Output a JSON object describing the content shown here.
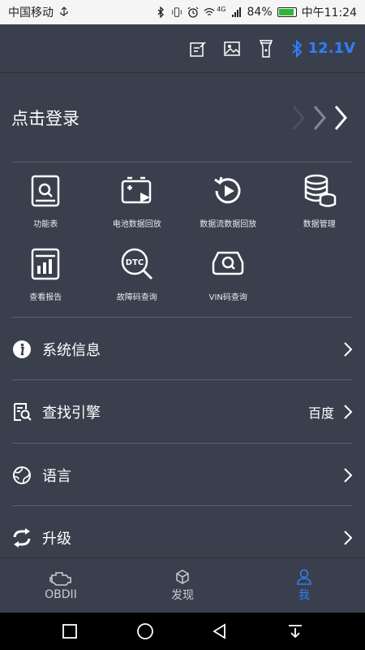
{
  "status_bar": {
    "carrier": "中国移动",
    "network": "4G",
    "battery": "84%",
    "time": "中午11:24"
  },
  "top_bar": {
    "voltage": "12.1V",
    "icons": [
      "edit-note-icon",
      "image-icon",
      "flashlight-icon",
      "bluetooth-icon"
    ]
  },
  "login": {
    "label": "点击登录"
  },
  "features": [
    {
      "label": "功能表",
      "icon": "function-list-icon"
    },
    {
      "label": "电池数据回放",
      "icon": "battery-playback-icon"
    },
    {
      "label": "数据流数据回放",
      "icon": "data-stream-playback-icon"
    },
    {
      "label": "数据管理",
      "icon": "database-icon"
    },
    {
      "label": "查看报告",
      "icon": "report-icon"
    },
    {
      "label": "故障码查询",
      "icon": "dtc-search-icon"
    },
    {
      "label": "VIN码查询",
      "icon": "vin-search-icon"
    }
  ],
  "menu": {
    "system_info": {
      "label": "系统信息",
      "icon": "info-icon"
    },
    "search_engine": {
      "label": "查找引擎",
      "value": "百度",
      "icon": "search-doc-icon"
    },
    "language": {
      "label": "语言",
      "icon": "globe-icon"
    },
    "upgrade": {
      "label": "升级",
      "icon": "refresh-icon"
    }
  },
  "bottom_nav": {
    "obd": "OBDII",
    "discover": "发现",
    "me": "我"
  },
  "colors": {
    "accent": "#2f7ff6",
    "background": "#3a3f4d",
    "battery_green": "#2fb53a"
  }
}
